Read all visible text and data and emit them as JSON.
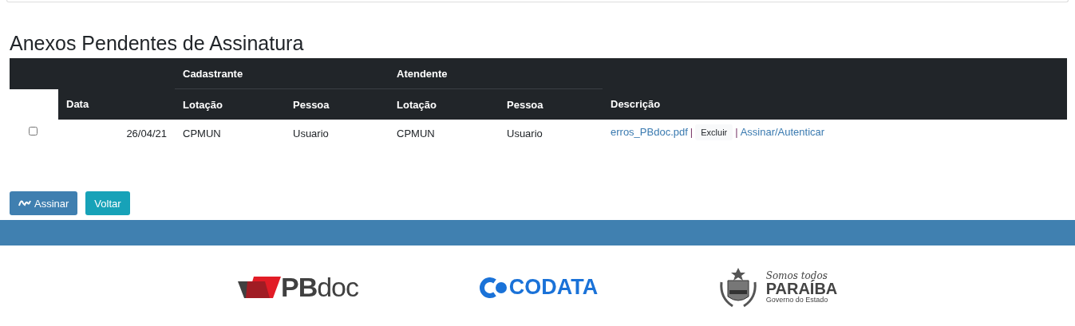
{
  "heading": "Anexos Pendentes de Assinatura",
  "table": {
    "groups": [
      {
        "label": "Cadastrante"
      },
      {
        "label": "Atendente"
      }
    ],
    "columns": [
      "Data",
      "Lotação",
      "Pessoa",
      "Lotação",
      "Pessoa",
      "Descrição"
    ],
    "rows": [
      {
        "checked": false,
        "cells": [
          "26/04/21",
          "CPMUN",
          "Usuario",
          "CPMUN",
          "Usuario"
        ],
        "file": "erros_PBdoc.pdf",
        "separator_1": "|",
        "delete": "Excluir",
        "separator_2": "|",
        "sign_link": "Assinar/Autenticar"
      }
    ]
  },
  "buttons": [
    {
      "kind": "primary",
      "label": "Assinar",
      "icon": true
    },
    {
      "kind": "info",
      "label": "Voltar",
      "icon": false
    }
  ],
  "footer": {
    "logos": [
      {
        "kind": "pbdoc",
        "bold": "PB",
        "light": "doc"
      },
      {
        "kind": "codata",
        "text": "CODATA"
      },
      {
        "kind": "paraiba",
        "slogan": "Somos todos",
        "name": "PARAÍBA",
        "subtitle": "Governo do Estado"
      }
    ]
  }
}
